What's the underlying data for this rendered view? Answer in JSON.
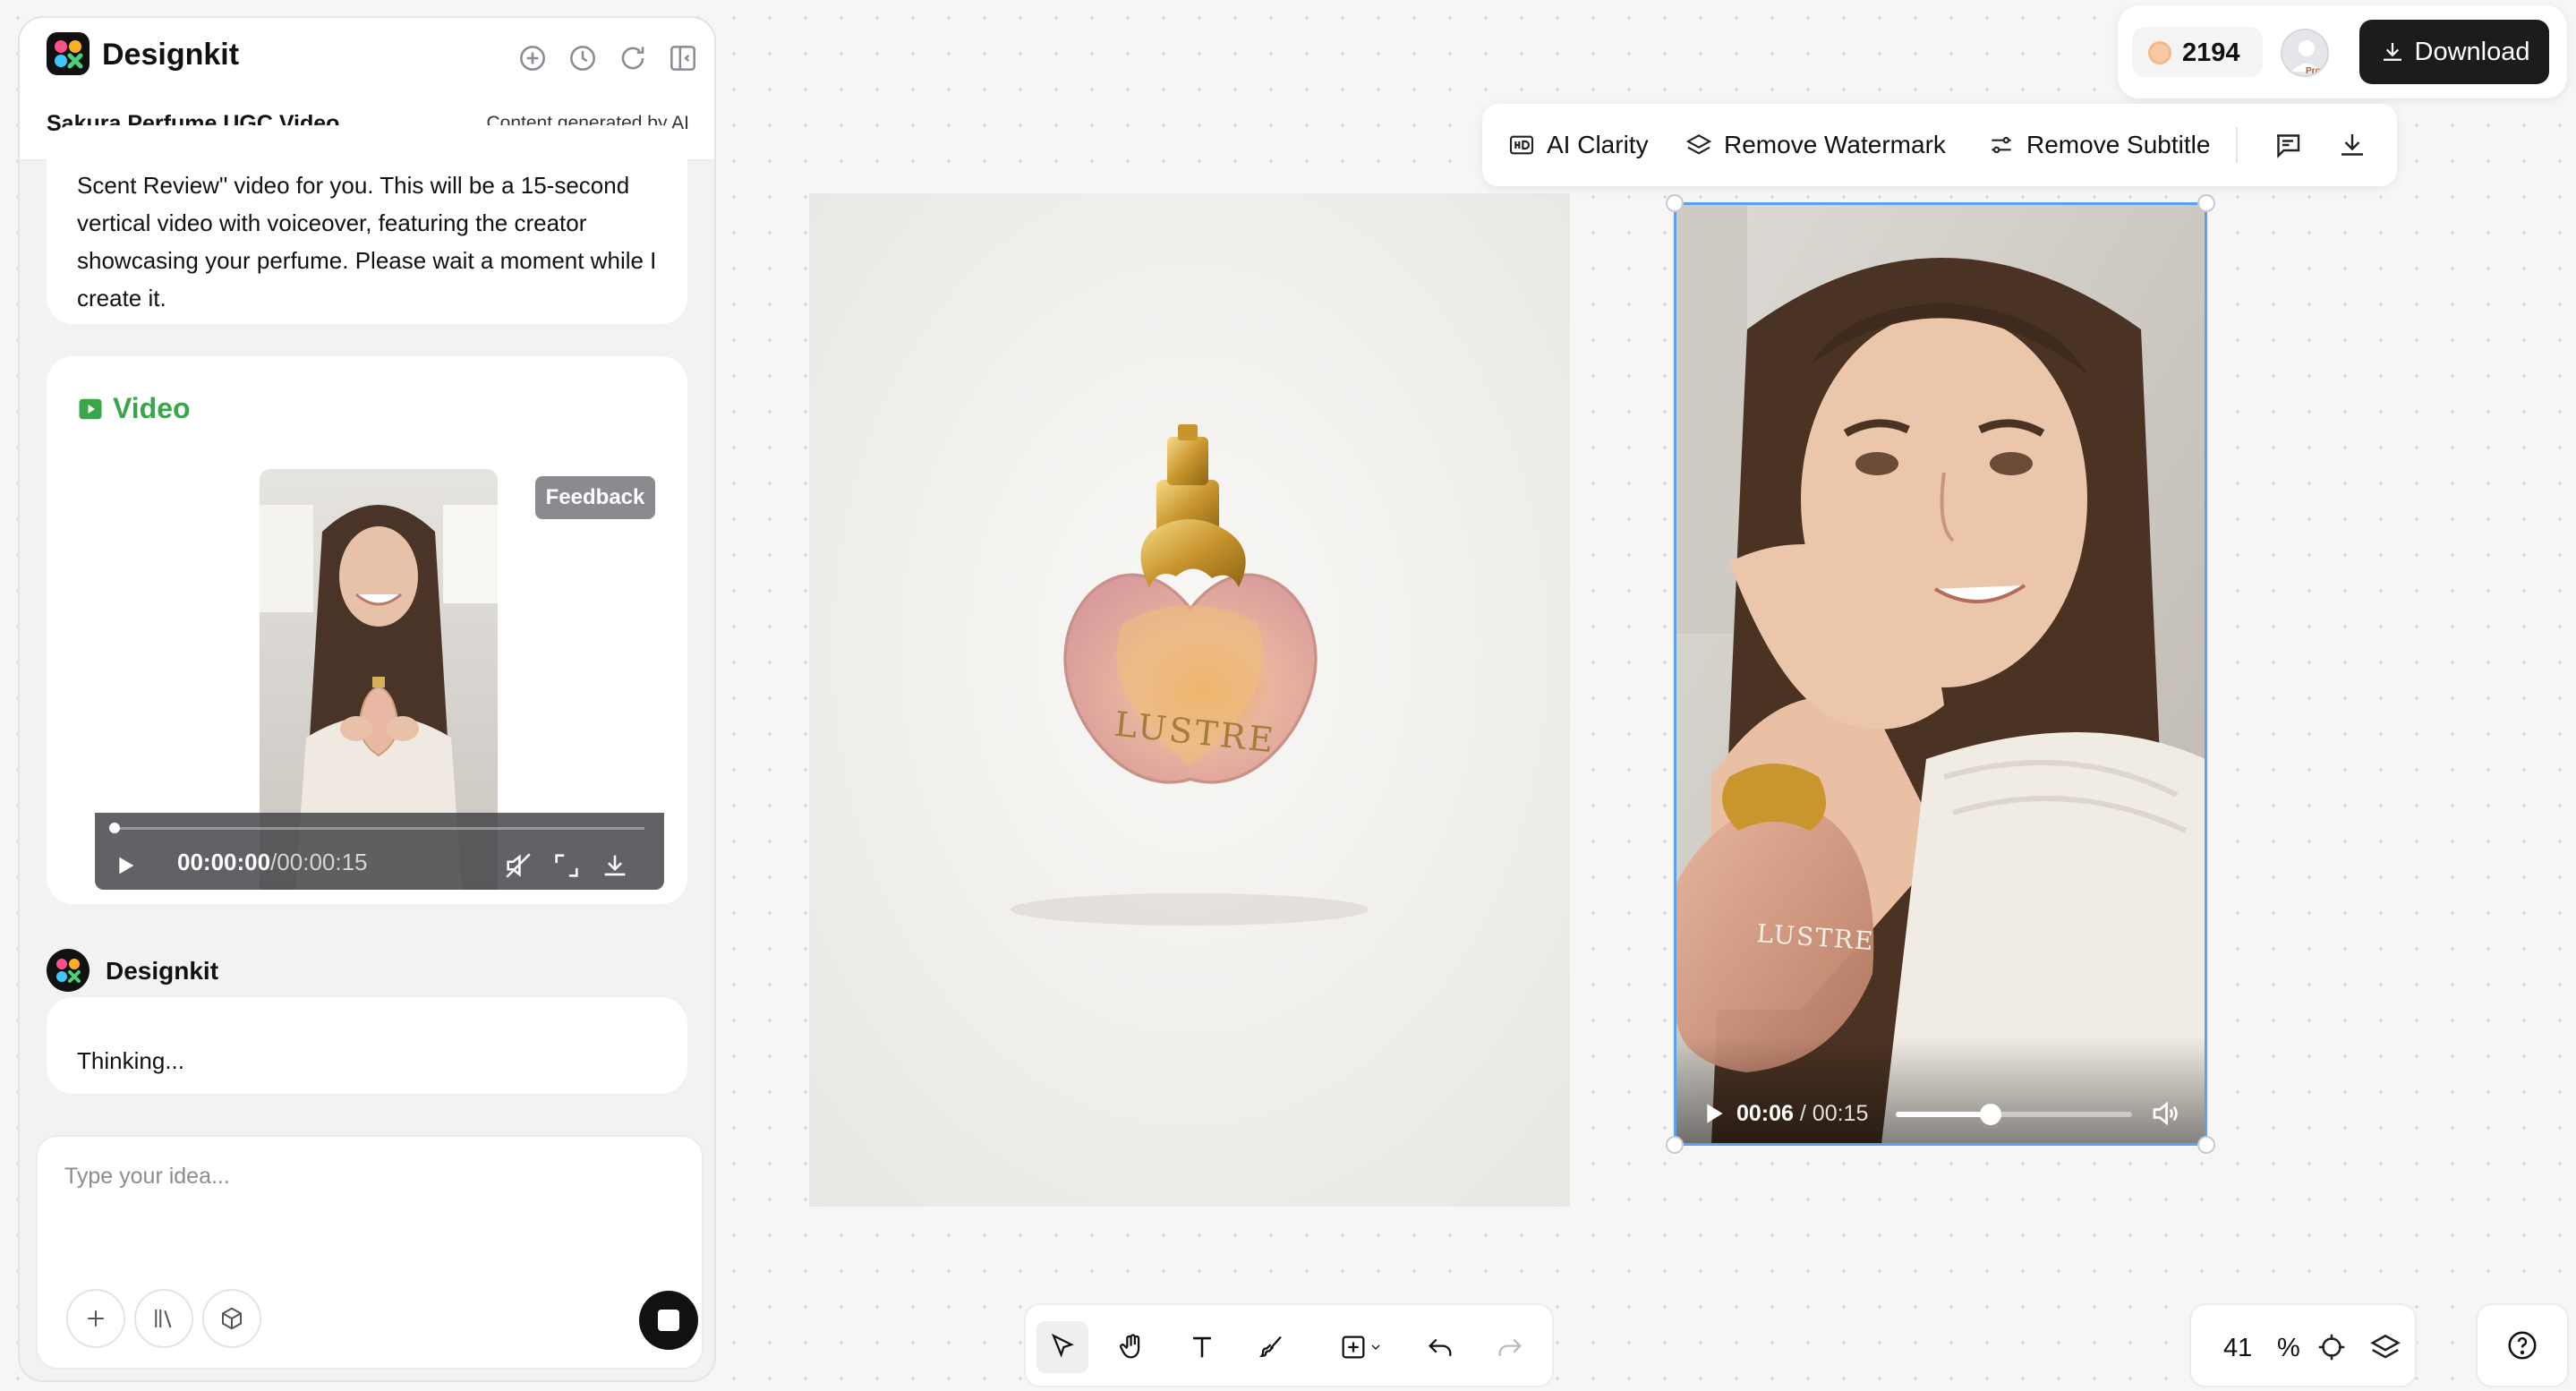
{
  "app": {
    "name": "Designkit"
  },
  "project": {
    "title": "Sakura Perfume UGC Video",
    "ai_note": "Content generated by AI"
  },
  "chat": {
    "assistant_message": "Scent Review\" video for you. This will be a 15-second vertical video with voiceover, featuring the creator showcasing your perfume. Please wait a moment while I create it.",
    "video_card": {
      "label": "Video",
      "current_time": "00:00:00",
      "duration": "/00:00:15",
      "feedback_label": "Feedback"
    },
    "agent_name": "Designkit",
    "thinking_text": "Thinking..."
  },
  "composer": {
    "placeholder": "Type your idea..."
  },
  "top_bar": {
    "credits": "2194",
    "pro_badge": "Pro",
    "download_label": "Download"
  },
  "image_toolbar": {
    "ai_clarity": "AI Clarity",
    "remove_watermark": "Remove Watermark",
    "remove_subtitle": "Remove Subtitle"
  },
  "canvas": {
    "product_label": "LUSTRE",
    "video_label": "LUSTRE",
    "video_player": {
      "current_time": "00:06",
      "duration": "/ 00:15",
      "progress": 0.4
    }
  },
  "zoom": {
    "value": "41",
    "unit": "%"
  },
  "colors": {
    "accent": "#3aa64a",
    "selection": "#5aa1f0",
    "dark_button": "#1c1c1e"
  }
}
